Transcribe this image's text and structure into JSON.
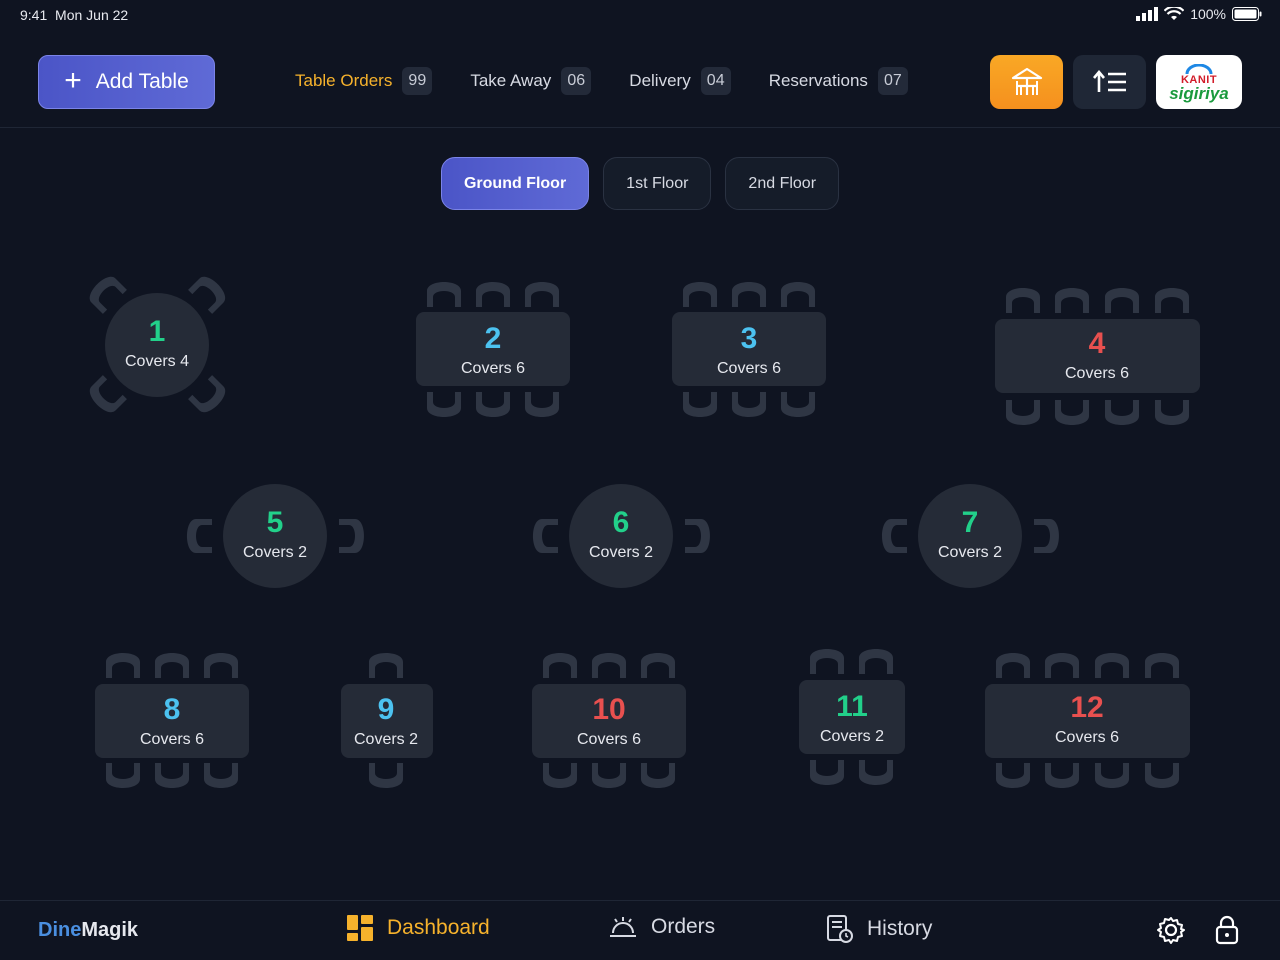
{
  "status": {
    "time": "9:41",
    "date": "Mon Jun 22",
    "battery": "100%"
  },
  "header": {
    "add_table_label": "Add Table",
    "tabs": [
      {
        "label": "Table Orders",
        "count": "99",
        "active": true
      },
      {
        "label": "Take Away",
        "count": "06",
        "active": false
      },
      {
        "label": "Delivery",
        "count": "04",
        "active": false
      },
      {
        "label": "Reservations",
        "count": "07",
        "active": false
      }
    ],
    "logo_top": "KANIT",
    "logo_bottom": "sigiriya"
  },
  "floors": [
    "Ground Floor",
    "1st Floor",
    "2nd Floor"
  ],
  "active_floor": "Ground Floor",
  "colors": {
    "green": "#22d08a",
    "blue": "#4cc2f0",
    "red": "#e8504f",
    "accent": "#f6b22c"
  },
  "tables": [
    {
      "number": "1",
      "covers": "Covers 4",
      "status_color": "#22d08a"
    },
    {
      "number": "2",
      "covers": "Covers 6",
      "status_color": "#4cc2f0"
    },
    {
      "number": "3",
      "covers": "Covers 6",
      "status_color": "#4cc2f0"
    },
    {
      "number": "4",
      "covers": "Covers 6",
      "status_color": "#e8504f"
    },
    {
      "number": "5",
      "covers": "Covers 2",
      "status_color": "#22d08a"
    },
    {
      "number": "6",
      "covers": "Covers 2",
      "status_color": "#22d08a"
    },
    {
      "number": "7",
      "covers": "Covers 2",
      "status_color": "#22d08a"
    },
    {
      "number": "8",
      "covers": "Covers 6",
      "status_color": "#4cc2f0"
    },
    {
      "number": "9",
      "covers": "Covers 2",
      "status_color": "#4cc2f0"
    },
    {
      "number": "10",
      "covers": "Covers 6",
      "status_color": "#e8504f"
    },
    {
      "number": "11",
      "covers": "Covers 2",
      "status_color": "#22d08a"
    },
    {
      "number": "12",
      "covers": "Covers 6",
      "status_color": "#e8504f"
    }
  ],
  "bottom_nav": {
    "brand_a": "Dine",
    "brand_b": "Magik",
    "items": [
      {
        "label": "Dashboard",
        "icon": "dashboard-icon",
        "active": true
      },
      {
        "label": "Orders",
        "icon": "cloche-icon",
        "active": false
      },
      {
        "label": "History",
        "icon": "history-icon",
        "active": false
      }
    ]
  }
}
